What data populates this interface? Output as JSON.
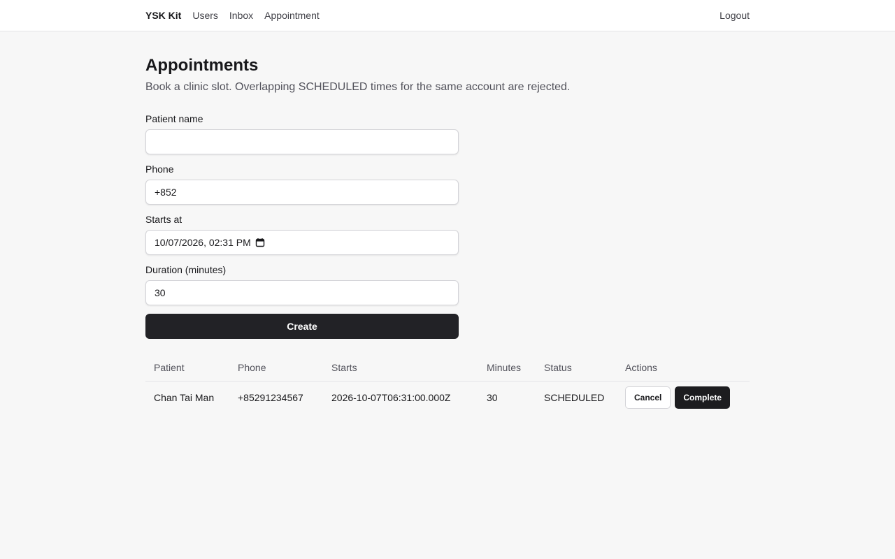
{
  "nav": {
    "brand": "YSK Kit",
    "links": [
      "Users",
      "Inbox",
      "Appointment"
    ],
    "logout": "Logout"
  },
  "page": {
    "title": "Appointments",
    "subtitle": "Book a clinic slot. Overlapping SCHEDULED times for the same account are rejected."
  },
  "form": {
    "patient_name": {
      "label": "Patient name",
      "value": ""
    },
    "phone": {
      "label": "Phone",
      "value": "+852"
    },
    "starts_at": {
      "label": "Starts at",
      "value": "10/07/2026, 02:31 PM",
      "icon": "calendar-icon"
    },
    "duration": {
      "label": "Duration (minutes)",
      "value": "30"
    },
    "submit_label": "Create"
  },
  "table": {
    "columns": [
      "Patient",
      "Phone",
      "Starts",
      "Minutes",
      "Status",
      "Actions"
    ],
    "rows": [
      {
        "patient": "Chan Tai Man",
        "phone": "+85291234567",
        "starts": "2026-10-07T06:31:00.000Z",
        "minutes": "30",
        "status": "SCHEDULED",
        "cancel_label": "Cancel",
        "complete_label": "Complete"
      }
    ]
  },
  "colors": {
    "background": "#f7f7f7",
    "primary_button": "#222226",
    "border": "#d4d4d8",
    "muted_text": "#52525b"
  }
}
